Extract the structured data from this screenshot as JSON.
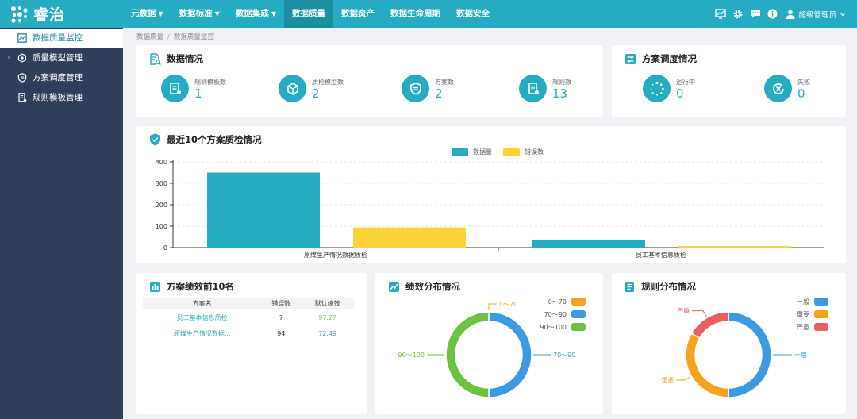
{
  "app": {
    "name": "睿治"
  },
  "topnav": [
    {
      "label": "元数据",
      "caret": "▼"
    },
    {
      "label": "数据标准",
      "caret": "▼"
    },
    {
      "label": "数据集成",
      "caret": "▼"
    },
    {
      "label": "数据质量",
      "caret": ""
    },
    {
      "label": "数据资产",
      "caret": ""
    },
    {
      "label": "数据生命周期",
      "caret": ""
    },
    {
      "label": "数据安全",
      "caret": ""
    }
  ],
  "user": {
    "name": "超级管理员"
  },
  "sidebar": {
    "items": [
      {
        "label": "数据质量监控"
      },
      {
        "label": "质量模型管理",
        "arrow": "›"
      },
      {
        "label": "方案调度管理"
      },
      {
        "label": "规则模板管理"
      }
    ]
  },
  "breadcrumb": [
    "数据质量",
    "数据质量监控"
  ],
  "data_overview": {
    "title": "数据情况",
    "stats": [
      {
        "label": "规则模板数",
        "value": "1",
        "icon": "rule-template-icon"
      },
      {
        "label": "质检模型数",
        "value": "2",
        "icon": "cube-icon"
      },
      {
        "label": "方案数",
        "value": "2",
        "icon": "badge-icon"
      },
      {
        "label": "规则数",
        "value": "13",
        "icon": "rules-icon"
      }
    ]
  },
  "schedule": {
    "title": "方案调度情况",
    "stats": [
      {
        "label": "运行中",
        "value": "0",
        "icon": "spinner-icon"
      },
      {
        "label": "失败",
        "value": "0",
        "icon": "failed-icon"
      }
    ]
  },
  "recent_checks": {
    "title": "最近10个方案质检情况",
    "legend": [
      {
        "name": "数据量",
        "color": "#25acc2"
      },
      {
        "name": "错误数",
        "color": "#fdd236"
      }
    ]
  },
  "top10": {
    "title": "方案绩效前10名",
    "columns": [
      "方案名",
      "错误数",
      "默认绩效"
    ],
    "rows": [
      {
        "name": "员工基本信息质检",
        "errors": "7",
        "score": "97.27",
        "score_color": "#8bc34a"
      },
      {
        "name": "原煤生产情况数据...",
        "errors": "94",
        "score": "72.49",
        "score_color": "#3b9ae1"
      }
    ]
  },
  "perf_dist": {
    "title": "绩效分布情况",
    "legend": [
      {
        "name": "0～70",
        "color": "#f7a21c"
      },
      {
        "name": "70～90",
        "color": "#3b9ae1"
      },
      {
        "name": "90～100",
        "color": "#6ac23f"
      }
    ]
  },
  "rule_dist": {
    "title": "规则分布情况",
    "legend": [
      {
        "name": "一般",
        "color": "#3b9ae1"
      },
      {
        "name": "重要",
        "color": "#f7a21c"
      },
      {
        "name": "严重",
        "color": "#ec5f5f"
      }
    ]
  },
  "chart_data": [
    {
      "type": "bar",
      "title": "最近10个方案质检情况",
      "categories": [
        "原煤生产情况数据质检",
        "员工基本信息质检"
      ],
      "series": [
        {
          "name": "数据量",
          "values": [
            350,
            35
          ],
          "color": "#25acc2"
        },
        {
          "name": "错误数",
          "values": [
            94,
            7
          ],
          "color": "#fdd236"
        }
      ],
      "yticks": [
        "0",
        "100",
        "200",
        "300",
        "400"
      ],
      "ylim": [
        0,
        400
      ],
      "legend_position": "top-center",
      "grid": true
    },
    {
      "type": "pie",
      "title": "绩效分布情况",
      "donut": true,
      "slices": [
        {
          "name": "0～70",
          "value": 0,
          "color": "#f7a21c"
        },
        {
          "name": "70～90",
          "value": 1,
          "color": "#3b9ae1"
        },
        {
          "name": "90～100",
          "value": 1,
          "color": "#6ac23f"
        }
      ]
    },
    {
      "type": "pie",
      "title": "规则分布情况",
      "donut": true,
      "slices": [
        {
          "name": "一般",
          "value": 6,
          "color": "#3b9ae1"
        },
        {
          "name": "重要",
          "value": 4,
          "color": "#f7a21c"
        },
        {
          "name": "严重",
          "value": 2,
          "color": "#ec5f5f"
        }
      ]
    }
  ]
}
